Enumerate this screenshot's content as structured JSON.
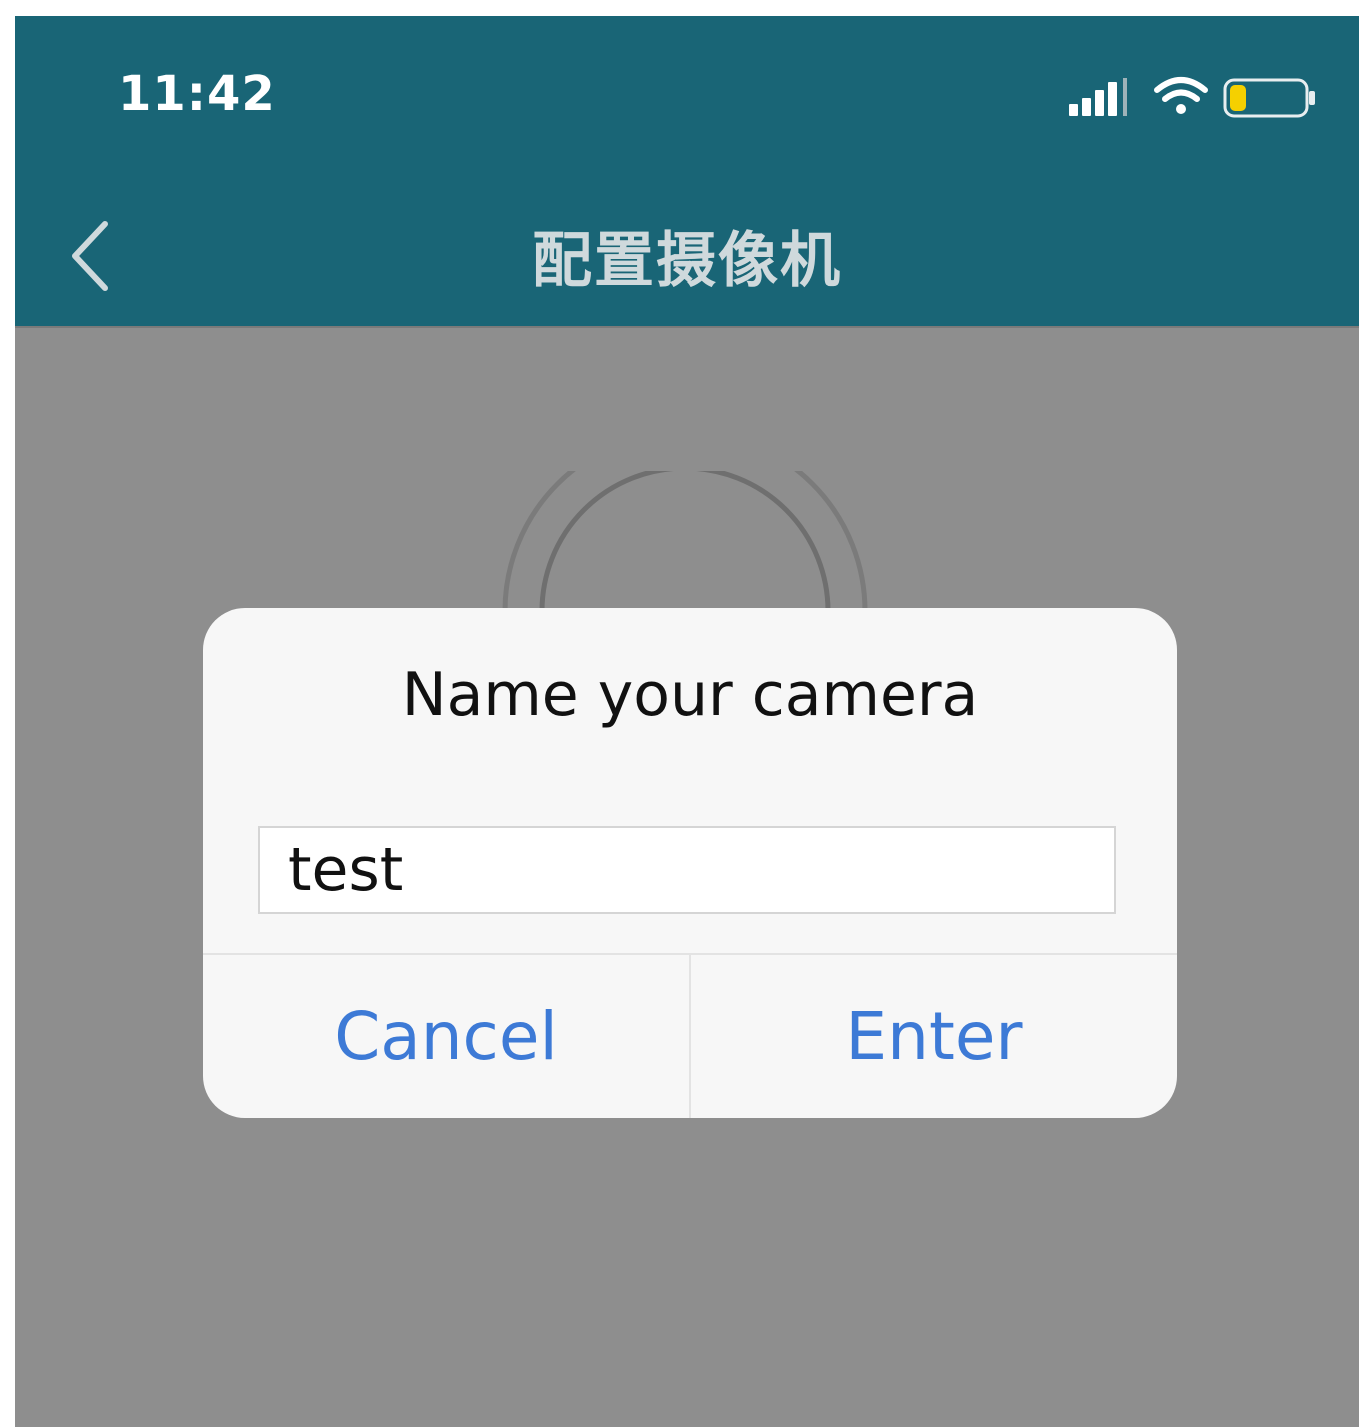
{
  "status_bar": {
    "time": "11:42",
    "icons": [
      "signal-icon",
      "wifi-icon",
      "battery-icon"
    ],
    "battery_level": 0.2,
    "battery_color": "#f5d000"
  },
  "nav": {
    "back_icon": "chevron-left-icon",
    "title": "配置摄像机"
  },
  "dialog": {
    "title": "Name your camera",
    "input_value": "test",
    "cancel_label": "Cancel",
    "enter_label": "Enter"
  },
  "colors": {
    "header": "#196576",
    "overlay": "#8e8e8e",
    "dialog_bg": "#f7f7f7",
    "button_text": "#3d7ad6"
  }
}
